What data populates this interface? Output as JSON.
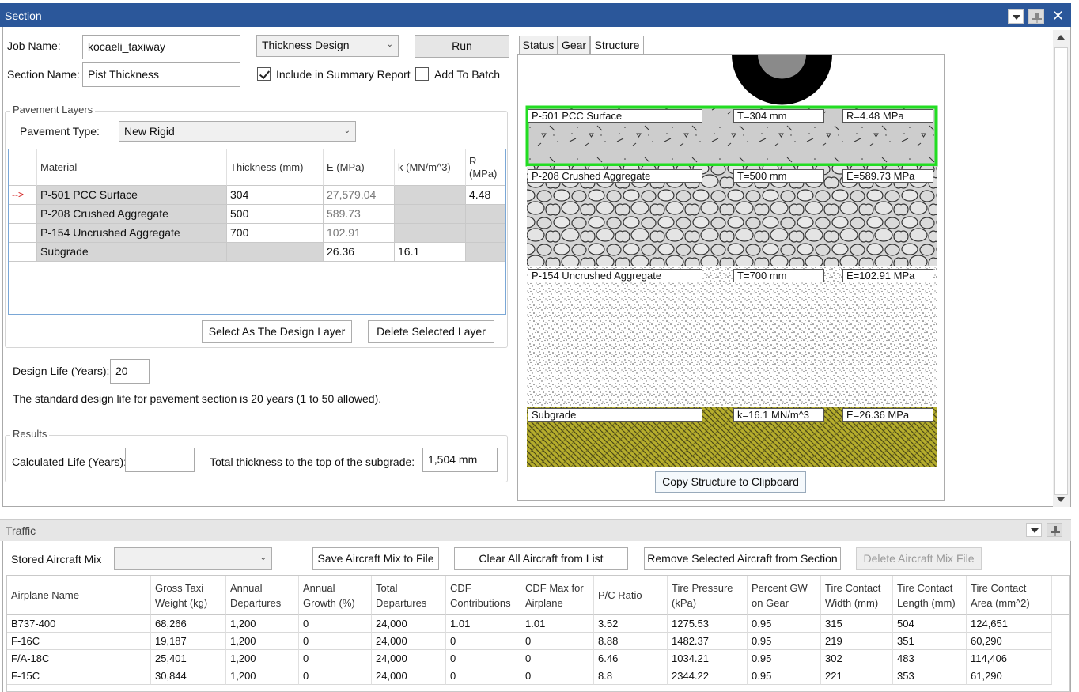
{
  "window": {
    "title": "Section"
  },
  "job": {
    "job_name_label": "Job Name:",
    "job_name_value": "kocaeli_taxiway",
    "section_name_label": "Section Name:",
    "section_name_value": "Pist Thickness",
    "mode_value": "Thickness Design",
    "run_label": "Run",
    "include_summary_label": "Include in Summary Report",
    "include_summary_checked": true,
    "add_to_batch_label": "Add To Batch",
    "add_to_batch_checked": false
  },
  "pavement_layers": {
    "group_title": "Pavement Layers",
    "pavement_type_label": "Pavement Type:",
    "pavement_type_value": "New Rigid",
    "columns": [
      "Material",
      "Thickness (mm)",
      "E (MPa)",
      "k (MN/m^3)",
      "R\n(MPa)"
    ],
    "rows": [
      {
        "marker": "-->",
        "material": "P-501 PCC Surface",
        "thickness": "304",
        "e": "27,579.04",
        "k": "",
        "r": "4.48"
      },
      {
        "marker": "",
        "material": "P-208 Crushed Aggregate",
        "thickness": "500",
        "e": "589.73",
        "k": "",
        "r": ""
      },
      {
        "marker": "",
        "material": "P-154 Uncrushed Aggregate",
        "thickness": "700",
        "e": "102.91",
        "k": "",
        "r": ""
      },
      {
        "marker": "",
        "material": "Subgrade",
        "thickness": "",
        "e": "26.36",
        "k": "16.1",
        "r": ""
      }
    ],
    "select_design_layer_label": "Select As The Design Layer",
    "delete_layer_label": "Delete Selected Layer"
  },
  "design_life": {
    "label": "Design Life (Years):",
    "value": "20",
    "note": "The standard design life for pavement section is 20 years (1 to 50 allowed)."
  },
  "results": {
    "group_title": "Results",
    "calculated_life_label": "Calculated Life (Years):",
    "calculated_life_value": "",
    "total_thickness_label": "Total thickness to the top of the subgrade:",
    "total_thickness_value": "1,504 mm"
  },
  "tabs": [
    {
      "label": "Status",
      "active": false
    },
    {
      "label": "Gear",
      "active": false
    },
    {
      "label": "Structure",
      "active": true
    }
  ],
  "structure": {
    "layers": [
      {
        "name": "P-501 PCC Surface",
        "thickness": "T=304 mm",
        "modulus": "R=4.48 MPa"
      },
      {
        "name": "P-208 Crushed Aggregate",
        "thickness": "T=500 mm",
        "modulus": "E=589.73 MPa"
      },
      {
        "name": "P-154 Uncrushed Aggregate",
        "thickness": "T=700 mm",
        "modulus": "E=102.91 MPa"
      },
      {
        "name": "Subgrade",
        "thickness": "k=16.1 MN/m^3",
        "modulus": "E=26.36 MPa"
      }
    ],
    "copy_label": "Copy Structure to Clipboard",
    "colors": {
      "surface_border": "#22dd22",
      "pcc": "#cfcfcf",
      "aggregate": "#c8c8c8",
      "subgrade": "#b5ad2c"
    }
  },
  "traffic": {
    "title": "Traffic",
    "stored_mix_label": "Stored Aircraft Mix",
    "stored_mix_value": "",
    "save_mix_label": "Save Aircraft Mix to File",
    "clear_all_label": "Clear All Aircraft from List",
    "remove_selected_label": "Remove Selected Aircraft from Section",
    "delete_mix_label": "Delete Aircraft Mix File",
    "columns": [
      "Airplane Name",
      "Gross Taxi\nWeight (kg)",
      "Annual\nDepartures",
      "Annual\nGrowth (%)",
      "Total\nDepartures",
      "CDF\nContributions",
      "CDF Max for\nAirplane",
      "P/C Ratio",
      "Tire Pressure\n(kPa)",
      "Percent GW\non Gear",
      "Tire Contact\nWidth (mm)",
      "Tire Contact\nLength (mm)",
      "Tire Contact\nArea (mm^2)"
    ],
    "rows": [
      [
        "B737-400",
        "68,266",
        "1,200",
        "0",
        "24,000",
        "1.01",
        "1.01",
        "3.52",
        "1275.53",
        "0.95",
        "315",
        "504",
        "124,651"
      ],
      [
        "F-16C",
        "19,187",
        "1,200",
        "0",
        "24,000",
        "0",
        "0",
        "8.88",
        "1482.37",
        "0.95",
        "219",
        "351",
        "60,290"
      ],
      [
        "F/A-18C",
        "25,401",
        "1,200",
        "0",
        "24,000",
        "0",
        "0",
        "6.46",
        "1034.21",
        "0.95",
        "302",
        "483",
        "114,406"
      ],
      [
        "F-15C",
        "30,844",
        "1,200",
        "0",
        "24,000",
        "0",
        "0",
        "8.8",
        "2344.22",
        "0.95",
        "221",
        "353",
        "61,290"
      ]
    ]
  }
}
